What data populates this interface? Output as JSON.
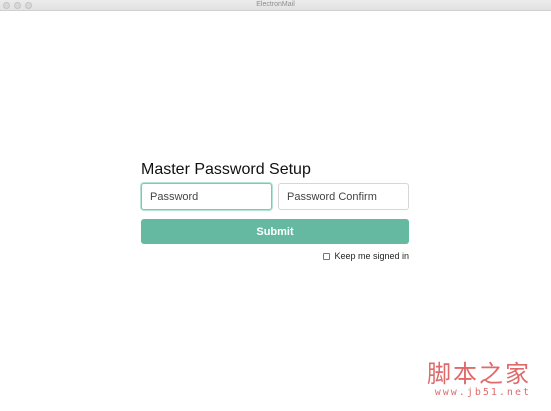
{
  "window": {
    "title": "ElectronMail"
  },
  "setup": {
    "heading": "Master Password Setup",
    "password_placeholder": "Password",
    "password_value": "",
    "confirm_placeholder": "Password Confirm",
    "confirm_value": "",
    "submit_label": "Submit",
    "keep_signed_in_label": "Keep me signed in",
    "keep_signed_in_checked": false
  },
  "watermark": {
    "text_cn": "脚本之家",
    "url": "www.jb51.net"
  },
  "colors": {
    "accent": "#64b9a0",
    "focus_border": "#7fc9b1",
    "watermark": "#e06a6a"
  }
}
